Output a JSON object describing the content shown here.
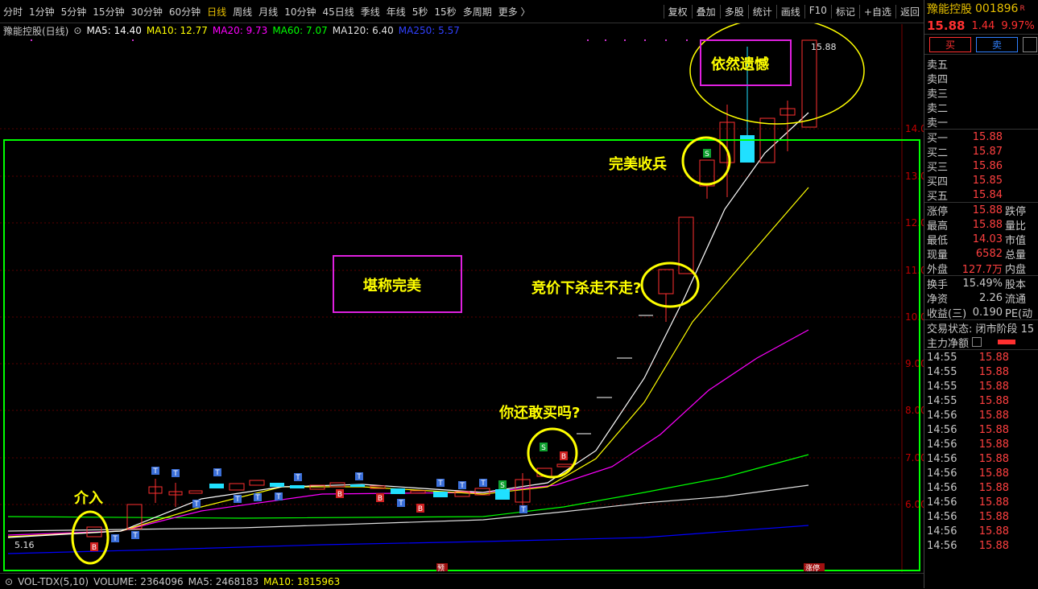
{
  "topbar": {
    "periods": [
      "分时",
      "1分钟",
      "5分钟",
      "15分钟",
      "30分钟",
      "60分钟",
      "日线",
      "周线",
      "月线",
      "10分钟",
      "45日线",
      "季线",
      "年线",
      "5秒",
      "15秒",
      "多周期",
      "更多 〉"
    ],
    "active_period": "日线",
    "right_buttons": [
      "复权",
      "叠加",
      "多股",
      "统计",
      "画线",
      "F10",
      "标记",
      "+自选",
      "返回"
    ]
  },
  "ma_legend": {
    "stock_label": "豫能控股(日线)",
    "ma5": "MA5: 14.40",
    "ma10": "MA10: 12.77",
    "ma20": "MA20: 9.73",
    "ma60": "MA60: 7.07",
    "ma120": "MA120: 6.40",
    "ma250": "MA250: 5.57"
  },
  "price_axis": [
    "14.00",
    "13.00",
    "12.00",
    "11.00",
    "10.00",
    "9.00",
    "8.00",
    "7.00",
    "6.00"
  ],
  "high_label": "15.88",
  "low_label": "5.16",
  "annotations": {
    "buy_in": "介入",
    "perfect": "堪称完美",
    "dare_buy": "你还敢买吗?",
    "auction": "竞价下杀走不走?",
    "close_perfect": "完美收兵",
    "regret": "依然遗憾"
  },
  "markers": {
    "b": "B",
    "s": "S",
    "t": "T"
  },
  "bottom_tags": {
    "a": "预",
    "b": "涨停"
  },
  "volume_bar": {
    "label": "VOL-TDX(5,10)",
    "volume": "VOLUME: 2364096",
    "ma5": "MA5: 2468183",
    "ma10": "MA10: 1815963"
  },
  "side": {
    "name": "豫能控股",
    "code": "001896",
    "r_badge": "R",
    "price": "15.88",
    "change": "1.44",
    "pct": "9.97%",
    "buy_btn": "买",
    "sell_btn": "卖",
    "sell_levels": [
      "卖五",
      "卖四",
      "卖三",
      "卖二",
      "卖一"
    ],
    "buy_levels": [
      {
        "label": "买一",
        "price": "15.88"
      },
      {
        "label": "买二",
        "price": "15.87"
      },
      {
        "label": "买三",
        "price": "15.86"
      },
      {
        "label": "买四",
        "price": "15.85"
      },
      {
        "label": "买五",
        "price": "15.84"
      }
    ],
    "stats": [
      {
        "label": "涨停",
        "value": "15.88",
        "extra": "跌停"
      },
      {
        "label": "最高",
        "value": "15.88",
        "extra": "量比"
      },
      {
        "label": "最低",
        "value": "14.03",
        "extra": "市值"
      },
      {
        "label": "现量",
        "value": "6582",
        "extra": "总量"
      },
      {
        "label": "外盘",
        "value": "127.7万",
        "extra": "内盘"
      }
    ],
    "stats2": [
      {
        "label": "换手",
        "value": "15.49%",
        "extra": "股本"
      },
      {
        "label": "净资",
        "value": "2.26",
        "extra": "流通"
      },
      {
        "label": "收益(三)",
        "value": "0.190",
        "extra": "PE(动"
      }
    ],
    "trade_state": "交易状态: 闭市阶段 15",
    "main_flow": "主力净额",
    "ticks": [
      {
        "t": "14:55",
        "p": "15.88"
      },
      {
        "t": "14:55",
        "p": "15.88"
      },
      {
        "t": "14:55",
        "p": "15.88"
      },
      {
        "t": "14:55",
        "p": "15.88"
      },
      {
        "t": "14:56",
        "p": "15.88"
      },
      {
        "t": "14:56",
        "p": "15.88"
      },
      {
        "t": "14:56",
        "p": "15.88"
      },
      {
        "t": "14:56",
        "p": "15.88"
      },
      {
        "t": "14:56",
        "p": "15.88"
      },
      {
        "t": "14:56",
        "p": "15.88"
      },
      {
        "t": "14:56",
        "p": "15.88"
      },
      {
        "t": "14:56",
        "p": "15.88"
      },
      {
        "t": "14:56",
        "p": "15.88"
      },
      {
        "t": "14:56",
        "p": "15.88"
      }
    ]
  },
  "colors": {
    "up": "#ff3030",
    "down": "#20e0ff",
    "ma5": "#ffffff",
    "ma10": "#ffff00",
    "ma20": "#ff00ff",
    "ma60": "#00ff00",
    "ma120": "#ffffff",
    "ma250": "#0000ff",
    "annotation": "#ffff00",
    "frame": "#00ff00",
    "box": "#e020e0"
  }
}
